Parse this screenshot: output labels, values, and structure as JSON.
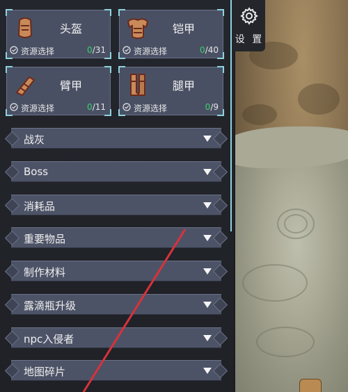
{
  "settings": {
    "label": "设 置",
    "icon": "gear-icon"
  },
  "equipment": [
    {
      "name": "头盔",
      "icon": "helmet-icon",
      "select_label": "资源选择",
      "count_found": "0",
      "count_total": "/31"
    },
    {
      "name": "铠甲",
      "icon": "chest-armor-icon",
      "select_label": "资源选择",
      "count_found": "0",
      "count_total": "/40"
    },
    {
      "name": "臂甲",
      "icon": "gauntlet-icon",
      "select_label": "资源选择",
      "count_found": "0",
      "count_total": "/11"
    },
    {
      "name": "腿甲",
      "icon": "greaves-icon",
      "select_label": "资源选择",
      "count_found": "0",
      "count_total": "/9"
    }
  ],
  "categories": [
    {
      "label": "战灰"
    },
    {
      "label": "Boss"
    },
    {
      "label": "消耗品"
    },
    {
      "label": "重要物品"
    },
    {
      "label": "制作材料"
    },
    {
      "label": "露滴瓶升级"
    },
    {
      "label": "npc入侵者"
    },
    {
      "label": "地图碎片"
    }
  ],
  "colors": {
    "accent": "#8ed3df",
    "count_found": "#39d16b",
    "annotation_line": "#d8323a"
  }
}
